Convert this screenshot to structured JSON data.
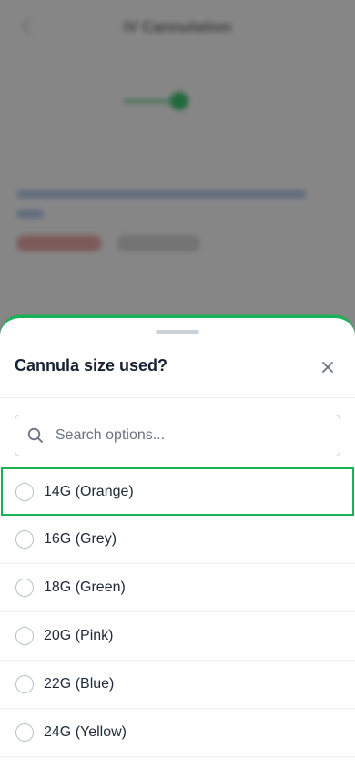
{
  "background": {
    "title": "IV Cannulation"
  },
  "sheet": {
    "title": "Cannula size used?",
    "search_placeholder": "Search options...",
    "options": [
      {
        "label": "14G (Orange)",
        "selected": false,
        "focused": true
      },
      {
        "label": "16G (Grey)",
        "selected": false,
        "focused": false
      },
      {
        "label": "18G (Green)",
        "selected": false,
        "focused": false
      },
      {
        "label": "20G (Pink)",
        "selected": false,
        "focused": false
      },
      {
        "label": "22G (Blue)",
        "selected": false,
        "focused": false
      },
      {
        "label": "24G (Yellow)",
        "selected": false,
        "focused": false
      }
    ]
  },
  "colors": {
    "accent": "#18b257",
    "overlay": "rgba(0,0,0,0.46)",
    "text": "#1f2a37"
  },
  "icons": {
    "close": "close-icon",
    "search": "search-icon"
  }
}
